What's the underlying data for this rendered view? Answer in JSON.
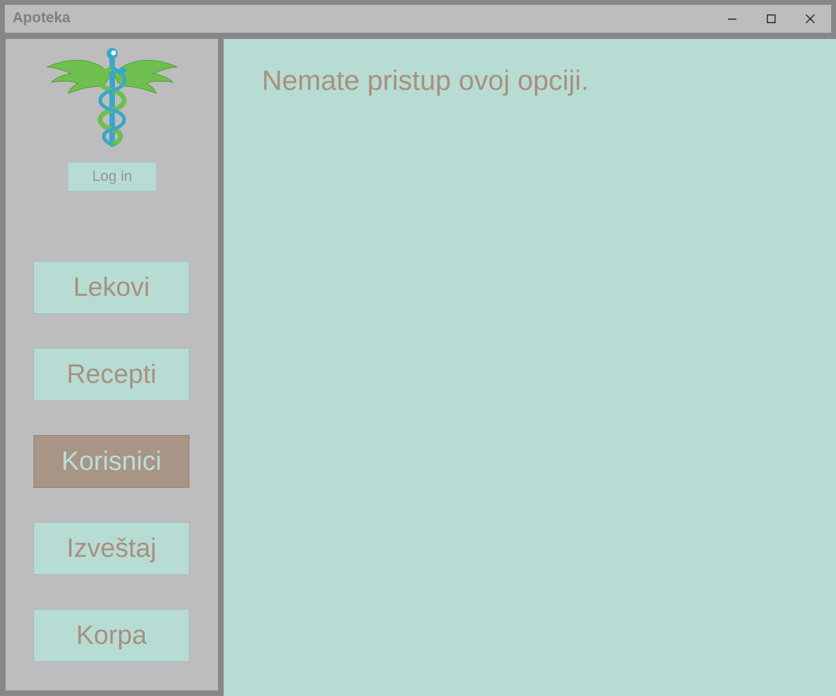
{
  "window": {
    "title": "Apoteka",
    "controls": [
      "minimize-icon",
      "maximize-icon",
      "close-icon"
    ]
  },
  "sidebar": {
    "logo": "caduceus-logo",
    "login_label": "Log in",
    "nav": [
      {
        "label": "Lekovi",
        "active": false
      },
      {
        "label": "Recepti",
        "active": false
      },
      {
        "label": "Korisnici",
        "active": true
      },
      {
        "label": "Izveštaj",
        "active": false
      },
      {
        "label": "Korpa",
        "active": false
      }
    ]
  },
  "main": {
    "message": "Nemate pristup ovoj opciji."
  },
  "colors": {
    "frame": "#87878a",
    "panel": "#bdbdbf",
    "content_bg": "#b7dcd3",
    "text_brown": "#a89080",
    "active_bg": "#a89585",
    "logo_green": "#6fbf4e",
    "logo_blue": "#3aa6c8"
  }
}
